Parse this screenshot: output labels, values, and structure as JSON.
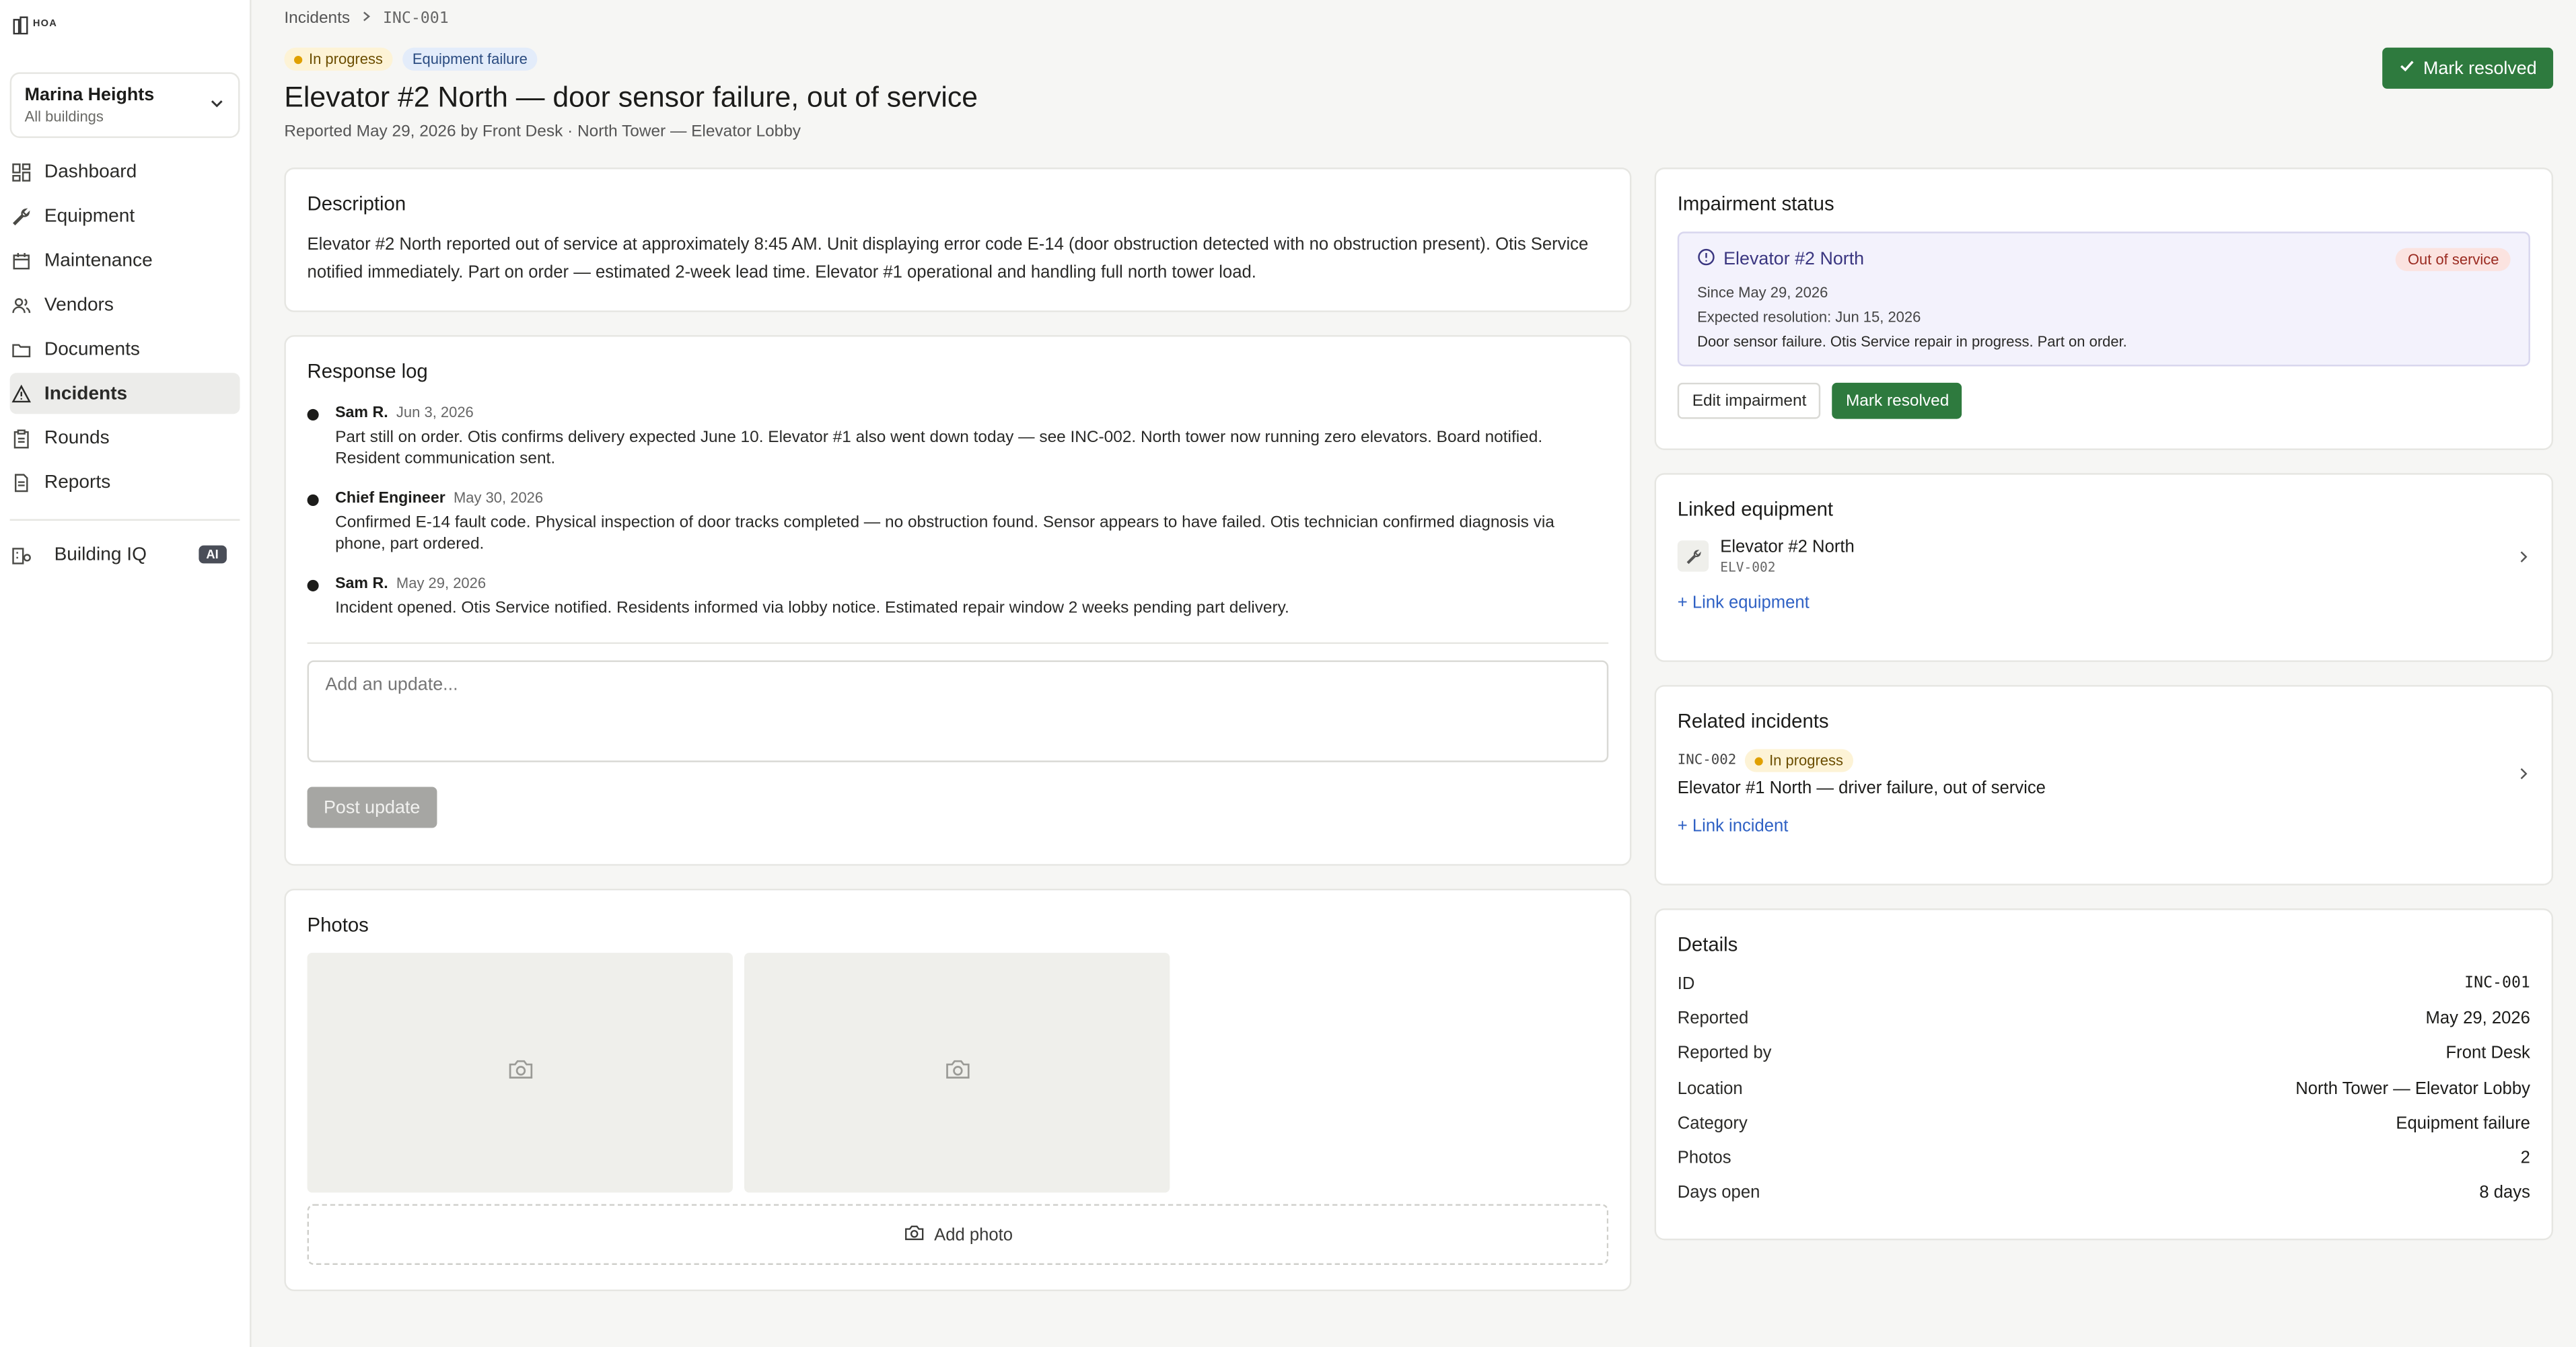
{
  "brand": {
    "logo_text": "HOA"
  },
  "org": {
    "name": "Marina Heights",
    "sub": "All buildings"
  },
  "nav": {
    "items": [
      {
        "label": "Dashboard",
        "icon": "dashboard-icon"
      },
      {
        "label": "Equipment",
        "icon": "wrench-icon"
      },
      {
        "label": "Maintenance",
        "icon": "calendar-icon"
      },
      {
        "label": "Vendors",
        "icon": "users-icon"
      },
      {
        "label": "Documents",
        "icon": "folder-icon"
      },
      {
        "label": "Incidents",
        "icon": "alert-triangle-icon",
        "active": true
      },
      {
        "label": "Rounds",
        "icon": "clipboard-icon"
      },
      {
        "label": "Reports",
        "icon": "document-icon"
      }
    ],
    "ai_item": {
      "label": "Building IQ",
      "badge": "AI"
    }
  },
  "breadcrumb": {
    "parent": "Incidents",
    "current": "INC-001"
  },
  "incident": {
    "status": "In progress",
    "category": "Equipment failure",
    "title": "Elevator #2 North — door sensor failure, out of service",
    "subtitle": "Reported May 29, 2026 by Front Desk · North Tower — Elevator Lobby",
    "resolve_label": "Mark resolved"
  },
  "description": {
    "heading": "Description",
    "text": "Elevator #2 North reported out of service at approximately 8:45 AM. Unit displaying error code E-14 (door obstruction detected with no obstruction present). Otis Service notified immediately. Part on order — estimated 2-week lead time. Elevator #1 operational and handling full north tower load."
  },
  "response_log": {
    "heading": "Response log",
    "entries": [
      {
        "who": "Sam R.",
        "when": "Jun 3, 2026",
        "text": "Part still on order. Otis confirms delivery expected June 10. Elevator #1 also went down today — see INC-002. North tower now running zero elevators. Board notified. Resident communication sent."
      },
      {
        "who": "Chief Engineer",
        "when": "May 30, 2026",
        "text": "Confirmed E-14 fault code. Physical inspection of door tracks completed — no obstruction found. Sensor appears to have failed. Otis technician confirmed diagnosis via phone, part ordered."
      },
      {
        "who": "Sam R.",
        "when": "May 29, 2026",
        "text": "Incident opened. Otis Service notified. Residents informed via lobby notice. Estimated repair window 2 weeks pending part delivery."
      }
    ],
    "placeholder": "Add an update...",
    "post_label": "Post update"
  },
  "photos": {
    "heading": "Photos",
    "add_label": "Add photo"
  },
  "impairment": {
    "heading": "Impairment status",
    "equipment": "Elevator #2 North",
    "pill": "Out of service",
    "since": "Since May 29, 2026",
    "expected": "Expected resolution: Jun 15, 2026",
    "note": "Door sensor failure. Otis Service repair in progress. Part on order.",
    "edit_label": "Edit impairment",
    "resolve_label": "Mark resolved"
  },
  "linked": {
    "heading": "Linked equipment",
    "name": "Elevator #2 North",
    "id": "ELV-002",
    "add_label": "+ Link equipment"
  },
  "related": {
    "heading": "Related incidents",
    "id": "INC-002",
    "status": "In progress",
    "title": "Elevator #1 North — driver failure, out of service",
    "add_label": "+ Link incident"
  },
  "details": {
    "heading": "Details",
    "rows": [
      {
        "k": "ID",
        "v": "INC-001"
      },
      {
        "k": "Reported",
        "v": "May 29, 2026"
      },
      {
        "k": "Reported by",
        "v": "Front Desk"
      },
      {
        "k": "Location",
        "v": "North Tower — Elevator Lobby"
      },
      {
        "k": "Category",
        "v": "Equipment failure"
      },
      {
        "k": "Photos",
        "v": "2"
      },
      {
        "k": "Days open",
        "v": "8 days"
      }
    ]
  },
  "colors": {
    "accent_green": "#2e7a3e",
    "link_blue": "#2f61c4",
    "warning_dot": "#e0a000",
    "danger_pill": "#fbe3e0"
  }
}
